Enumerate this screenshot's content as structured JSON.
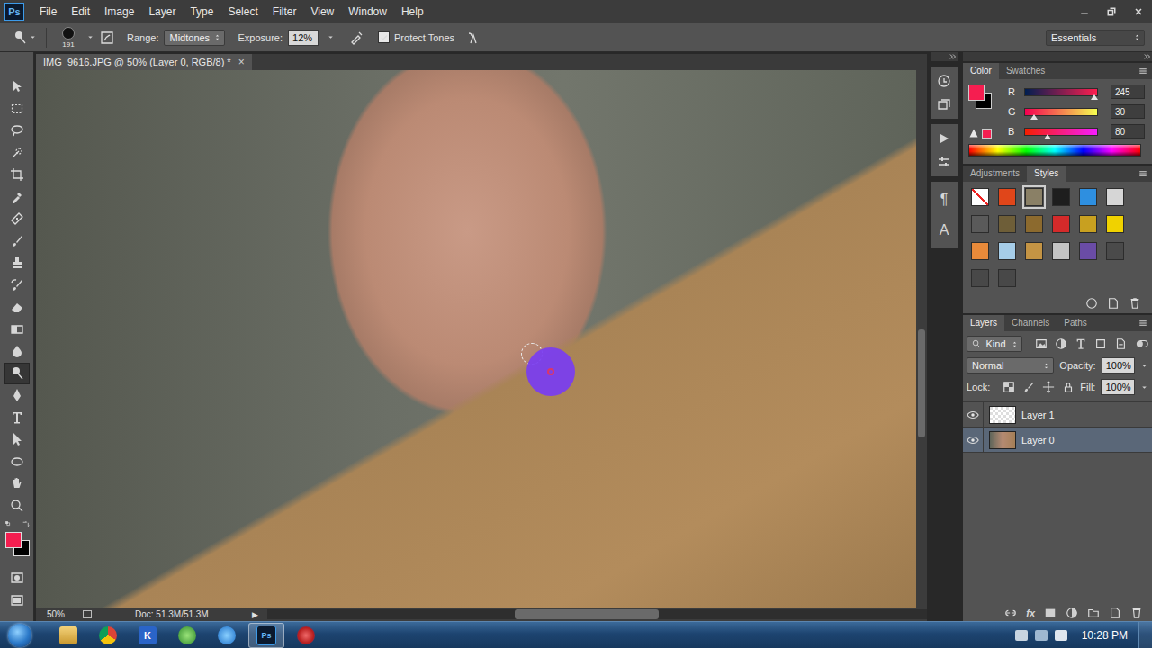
{
  "app": {
    "logo": "Ps"
  },
  "menu": [
    "File",
    "Edit",
    "Image",
    "Layer",
    "Type",
    "Select",
    "Filter",
    "View",
    "Window",
    "Help"
  ],
  "options": {
    "brush_size": "191",
    "range_label": "Range:",
    "range_value": "Midtones",
    "exposure_label": "Exposure:",
    "exposure_value": "12%",
    "protect_tones": {
      "label": "Protect Tones",
      "checked": true
    }
  },
  "workspace": "Essentials",
  "tools": [
    {
      "kind": "move",
      "selected": false
    },
    {
      "kind": "marquee",
      "selected": false
    },
    {
      "kind": "lasso",
      "selected": false
    },
    {
      "kind": "quick-select",
      "selected": false
    },
    {
      "kind": "crop",
      "selected": false
    },
    {
      "kind": "eyedropper",
      "selected": false
    },
    {
      "kind": "healing",
      "selected": false
    },
    {
      "kind": "brush",
      "selected": false
    },
    {
      "kind": "stamp",
      "selected": false
    },
    {
      "kind": "history-brush",
      "selected": false
    },
    {
      "kind": "eraser",
      "selected": false
    },
    {
      "kind": "gradient",
      "selected": false
    },
    {
      "kind": "blur",
      "selected": false
    },
    {
      "kind": "dodge",
      "selected": true
    },
    {
      "kind": "pen",
      "selected": false
    },
    {
      "kind": "type",
      "selected": false
    },
    {
      "kind": "path-select",
      "selected": false
    },
    {
      "kind": "ellipse",
      "selected": false
    },
    {
      "kind": "hand",
      "selected": false
    },
    {
      "kind": "zoom",
      "selected": false
    }
  ],
  "colors": {
    "foreground": "#f51e50",
    "background": "#000000"
  },
  "document": {
    "title": "IMG_9616.JPG @ 50% (Layer 0, RGB/8) *",
    "close": "×",
    "zoom": "50%",
    "doc_info": "Doc: 51.3M/51.3M",
    "menu_arrow": "▶"
  },
  "panel_strip_glyphs": [
    "¶",
    "A"
  ],
  "color_panel": {
    "tabs": [
      {
        "label": "Color",
        "selected": true
      },
      {
        "label": "Swatches",
        "selected": false
      }
    ],
    "channels": [
      {
        "label": "R",
        "value": "245",
        "level": 0.96
      },
      {
        "label": "G",
        "value": "30",
        "level": 0.12
      },
      {
        "label": "B",
        "value": "80",
        "level": 0.31
      }
    ]
  },
  "styles_panel": {
    "tabs": [
      {
        "label": "Adjustments",
        "selected": false
      },
      {
        "label": "Styles",
        "selected": true
      }
    ],
    "styles": [
      {
        "kind": "none",
        "color": "#ffffff",
        "selected": false
      },
      {
        "kind": "style",
        "color": "#e0461a",
        "selected": false
      },
      {
        "kind": "style",
        "color": "#8a8066",
        "selected": true
      },
      {
        "kind": "style",
        "color": "#1e1e1e",
        "selected": false
      },
      {
        "kind": "style",
        "color": "#2e8fe0",
        "selected": false
      },
      {
        "kind": "style",
        "color": "#d6d6d6",
        "selected": false
      },
      {
        "kind": "style",
        "color": "#5a5a5a",
        "selected": false
      },
      {
        "kind": "style",
        "color": "#6e5e38",
        "selected": false
      },
      {
        "kind": "style",
        "color": "#8c6a2e",
        "selected": false
      },
      {
        "kind": "style",
        "color": "#d42a2a",
        "selected": false
      },
      {
        "kind": "style",
        "color": "#c8a020",
        "selected": false
      },
      {
        "kind": "style",
        "color": "#f0d200",
        "selected": false
      },
      {
        "kind": "style",
        "color": "#e88a3a",
        "selected": false
      },
      {
        "kind": "style",
        "color": "#a6cde8",
        "selected": false
      },
      {
        "kind": "style",
        "color": "#c49444",
        "selected": false
      },
      {
        "kind": "style",
        "color": "#c4c4c4",
        "selected": false
      },
      {
        "kind": "style",
        "color": "#6a4ca6",
        "selected": false
      },
      {
        "kind": "style",
        "color": "#4a4a4a",
        "selected": false
      },
      {
        "kind": "style",
        "color": "#484848",
        "selected": false
      },
      {
        "kind": "style",
        "color": "#484848",
        "selected": false
      }
    ]
  },
  "layers_panel": {
    "tabs": [
      {
        "label": "Layers",
        "selected": true
      },
      {
        "label": "Channels",
        "selected": false
      },
      {
        "label": "Paths",
        "selected": false
      }
    ],
    "filter": "Kind",
    "blend_mode": "Normal",
    "opacity_label": "Opacity:",
    "opacity": "100%",
    "lock_label": "Lock:",
    "fill_label": "Fill:",
    "fill": "100%",
    "layers": [
      {
        "name": "Layer 1",
        "visible": true,
        "selected": false,
        "kind": "blank"
      },
      {
        "name": "Layer 0",
        "visible": true,
        "selected": true,
        "kind": "photo"
      }
    ],
    "footer_fx": "fx"
  },
  "taskbar": {
    "apps": [
      {
        "kind": "explorer",
        "glyph": "",
        "selected": false
      },
      {
        "kind": "chrome",
        "glyph": "",
        "selected": false
      },
      {
        "kind": "keyboard",
        "glyph": "K",
        "selected": false
      },
      {
        "kind": "green",
        "glyph": "",
        "selected": false
      },
      {
        "kind": "blue",
        "glyph": "",
        "selected": false
      },
      {
        "kind": "photoshop",
        "glyph": "Ps",
        "selected": true
      },
      {
        "kind": "red",
        "glyph": "",
        "selected": false
      }
    ],
    "clock": "10:28 PM"
  }
}
